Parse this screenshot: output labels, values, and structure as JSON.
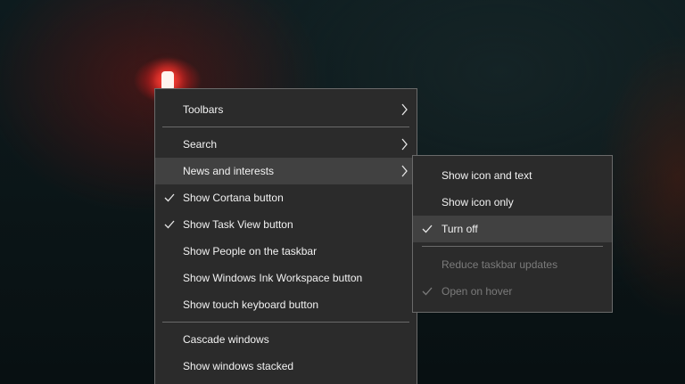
{
  "context_menu": {
    "items": [
      {
        "label": "Toolbars",
        "checked": false,
        "submenu": true,
        "icon": "chevron-right-icon"
      },
      {
        "label": "Search",
        "checked": false,
        "submenu": true,
        "icon": "chevron-right-icon"
      },
      {
        "label": "News and interests",
        "checked": false,
        "submenu": true,
        "highlighted": true,
        "icon": "chevron-right-icon"
      },
      {
        "label": "Show Cortana button",
        "checked": true,
        "icon": "checkmark-icon"
      },
      {
        "label": "Show Task View button",
        "checked": true,
        "icon": "checkmark-icon"
      },
      {
        "label": "Show People on the taskbar",
        "checked": false
      },
      {
        "label": "Show Windows Ink Workspace button",
        "checked": false
      },
      {
        "label": "Show touch keyboard button",
        "checked": false
      },
      {
        "label": "Cascade windows",
        "checked": false
      },
      {
        "label": "Show windows stacked",
        "checked": false
      }
    ]
  },
  "news_submenu": {
    "items": [
      {
        "label": "Show icon and text",
        "checked": false,
        "disabled": false
      },
      {
        "label": "Show icon only",
        "checked": false,
        "disabled": false
      },
      {
        "label": "Turn off",
        "checked": true,
        "highlighted": true,
        "disabled": false,
        "icon": "checkmark-icon"
      },
      {
        "label": "Reduce taskbar updates",
        "checked": false,
        "disabled": true
      },
      {
        "label": "Open on hover",
        "checked": true,
        "disabled": true,
        "icon": "checkmark-icon"
      }
    ]
  },
  "colors": {
    "menu_bg": "#2b2b2b",
    "menu_border": "#6a6a6a",
    "highlight_bg": "#414141",
    "text": "#f2f2f2",
    "disabled_text": "#7b7b7b",
    "accent_glow": "#ff3c32"
  }
}
